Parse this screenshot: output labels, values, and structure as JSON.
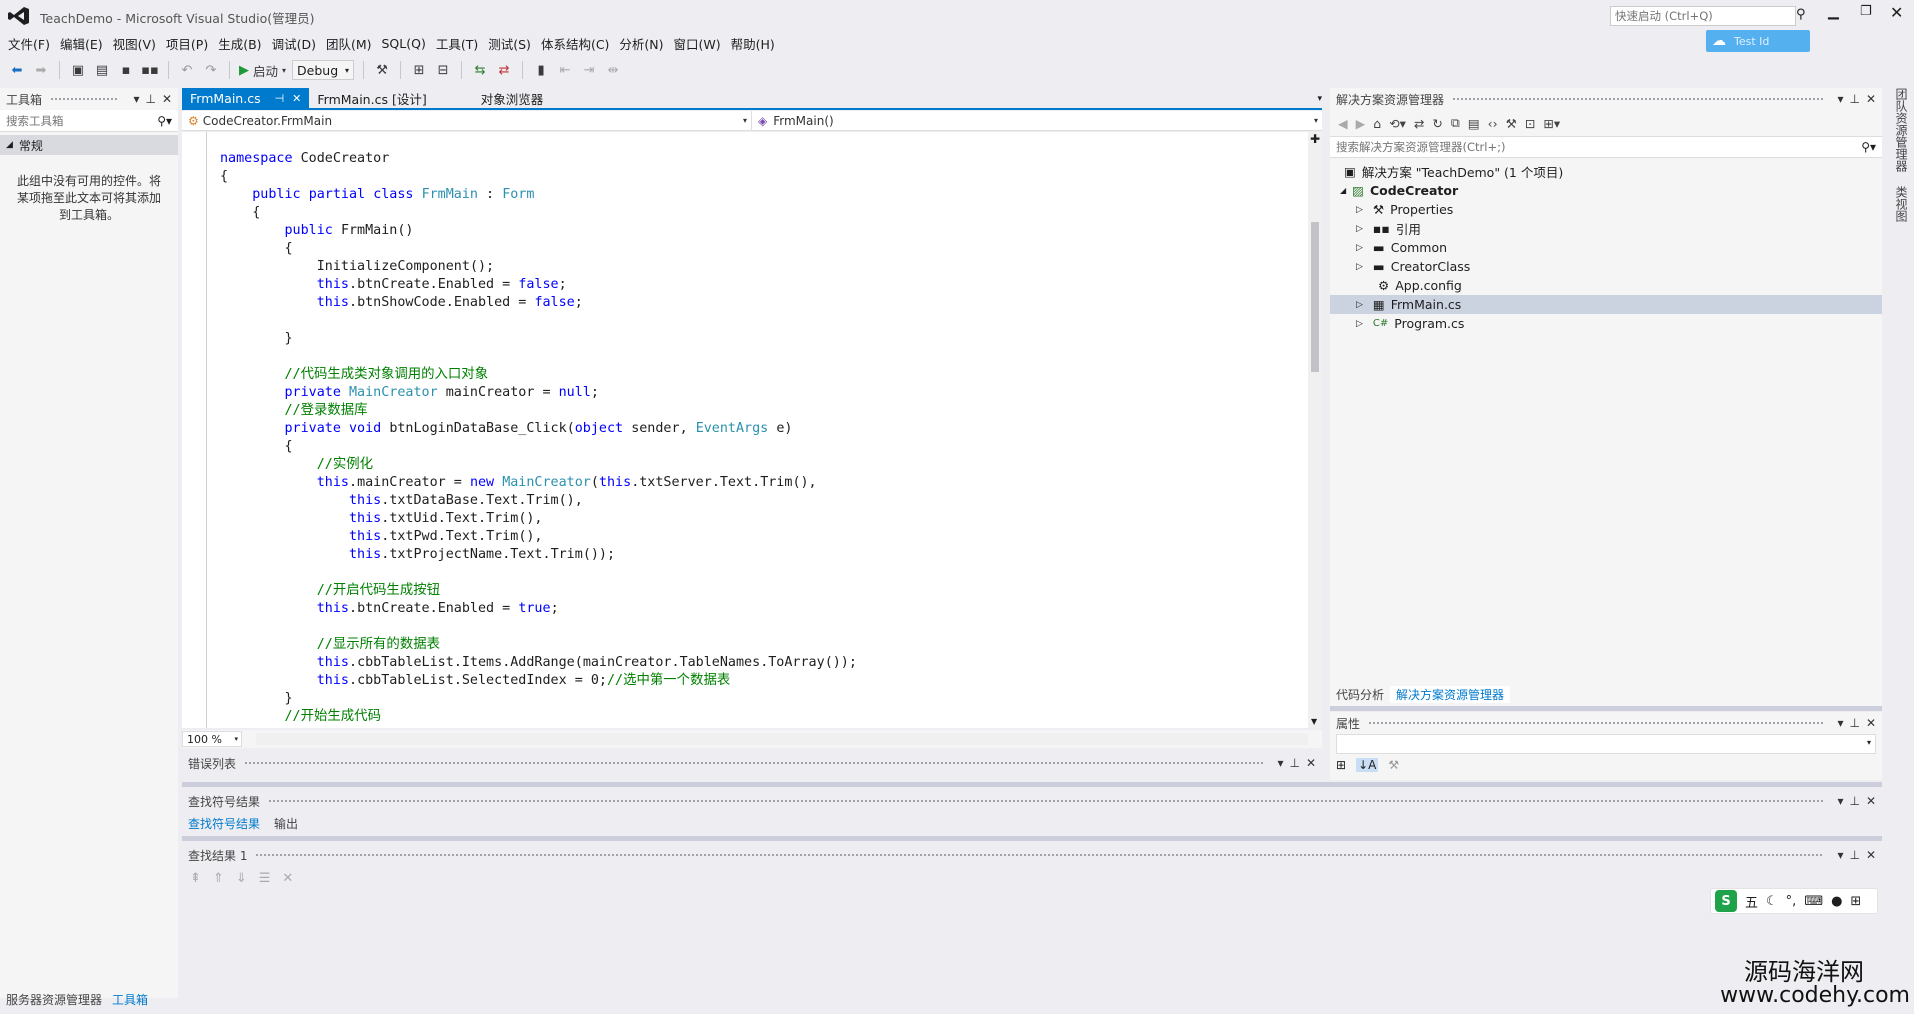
{
  "window": {
    "title": "TeachDemo - Microsoft Visual Studio(管理员)",
    "quick_launch_placeholder": "快速启动 (Ctrl+Q)",
    "user_button": "Test Id"
  },
  "menu": [
    "文件(F)",
    "编辑(E)",
    "视图(V)",
    "项目(P)",
    "生成(B)",
    "调试(D)",
    "团队(M)",
    "SQL(Q)",
    "工具(T)",
    "测试(S)",
    "体系结构(C)",
    "分析(N)",
    "窗口(W)",
    "帮助(H)"
  ],
  "toolbar": {
    "start_label": "启动",
    "config": "Debug"
  },
  "toolbox": {
    "title": "工具箱",
    "search_placeholder": "搜索工具箱",
    "group": "常规",
    "empty_text": "此组中没有可用的控件。将某项拖至此文本可将其添加到工具箱。",
    "bottom_tabs": [
      "服务器资源管理器",
      "工具箱"
    ]
  },
  "editor": {
    "tabs": [
      "FrmMain.cs",
      "FrmMain.cs [设计]",
      "对象浏览器"
    ],
    "nav_left": "CodeCreator.FrmMain",
    "nav_right": "FrmMain()",
    "zoom": "100 %",
    "lines": [
      "namespace CodeCreator",
      "{",
      "    public partial class FrmMain : Form",
      "    {",
      "        public FrmMain()",
      "        {",
      "            InitializeComponent();",
      "            this.btnCreate.Enabled = false;",
      "            this.btnShowCode.Enabled = false;",
      "",
      "        }",
      "",
      "        //代码生成类对象调用的入口对象",
      "        private MainCreator mainCreator = null;",
      "        //登录数据库",
      "        private void btnLoginDataBase_Click(object sender, EventArgs e)",
      "        {",
      "            //实例化",
      "            this.mainCreator = new MainCreator(this.txtServer.Text.Trim(),",
      "                this.txtDataBase.Text.Trim(),",
      "                this.txtUid.Text.Trim(),",
      "                this.txtPwd.Text.Trim(),",
      "                this.txtProjectName.Text.Trim());",
      "",
      "            //开启代码生成按钮",
      "            this.btnCreate.Enabled = true;",
      "",
      "            //显示所有的数据表",
      "            this.cbbTableList.Items.AddRange(mainCreator.TableNames.ToArray());",
      "            this.cbbTableList.SelectedIndex = 0;//选中第一个数据表",
      "        }",
      "        //开始生成代码"
    ]
  },
  "solution": {
    "title": "解决方案资源管理器",
    "search_placeholder": "搜索解决方案资源管理器(Ctrl+;)",
    "root": "解决方案 \"TeachDemo\" (1 个项目)",
    "project": "CodeCreator",
    "items": [
      "Properties",
      "引用",
      "Common",
      "CreatorClass",
      "App.config",
      "FrmMain.cs",
      "Program.cs"
    ],
    "bottom_tabs": [
      "代码分析",
      "解决方案资源管理器"
    ]
  },
  "properties": {
    "title": "属性"
  },
  "panels": {
    "error_list": "错误列表",
    "find_symbol": "查找符号结果",
    "find_tabs": [
      "查找符号结果",
      "输出"
    ],
    "find_results": "查找结果 1"
  },
  "ime": {
    "label": "五"
  },
  "watermark": {
    "line1": "源码海洋网",
    "line2": "www.codehy.com"
  },
  "side_tabs": [
    "团队资源管理器",
    "类视图"
  ]
}
